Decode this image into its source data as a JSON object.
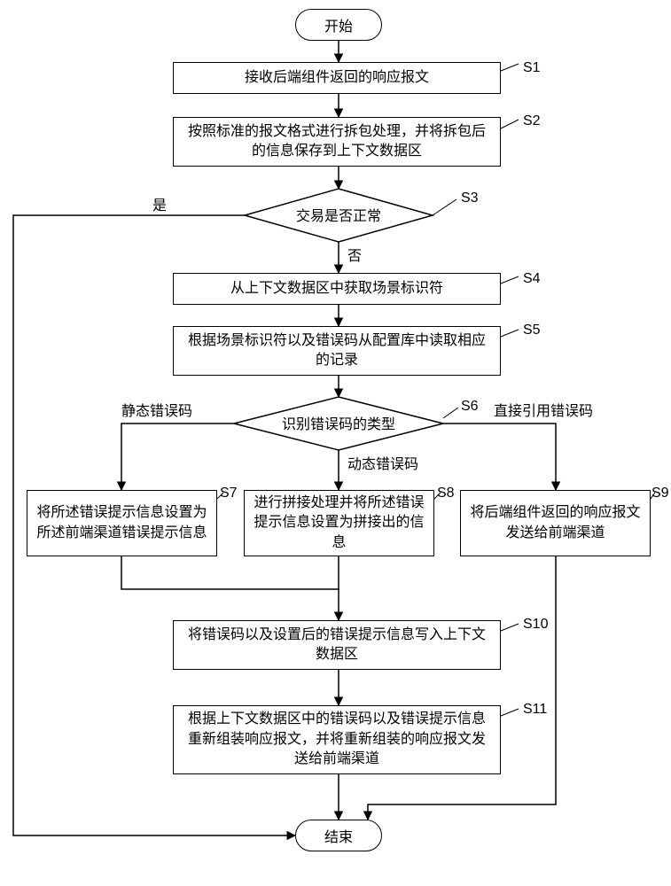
{
  "start": "开始",
  "end": "结束",
  "s1": {
    "label": "S1",
    "text": "接收后端组件返回的响应报文"
  },
  "s2": {
    "label": "S2",
    "text": "按照标准的报文格式进行拆包处理，并将拆包后的信息保存到上下文数据区"
  },
  "s3": {
    "label": "S3",
    "text": "交易是否正常"
  },
  "s4": {
    "label": "S4",
    "text": "从上下文数据区中获取场景标识符"
  },
  "s5": {
    "label": "S5",
    "text": "根据场景标识符以及错误码从配置库中读取相应的记录"
  },
  "s6": {
    "label": "S6",
    "text": "识别错误码的类型"
  },
  "s7": {
    "label": "S7",
    "text": "将所述错误提示信息设置为所述前端渠道错误提示信息"
  },
  "s8": {
    "label": "S8",
    "text": "进行拼接处理并将所述错误提示信息设置为拼接出的信息"
  },
  "s9": {
    "label": "S9",
    "text": "将后端组件返回的响应报文发送给前端渠道"
  },
  "s10": {
    "label": "S10",
    "text": "将错误码以及设置后的错误提示信息写入上下文数据区"
  },
  "s11": {
    "label": "S11",
    "text": "根据上下文数据区中的错误码以及错误提示信息重新组装响应报文，并将重新组装的响应报文发送给前端渠道"
  },
  "yes": "是",
  "no": "否",
  "staticCode": "静态错误码",
  "dynamicCode": "动态错误码",
  "directCode": "直接引用错误码"
}
